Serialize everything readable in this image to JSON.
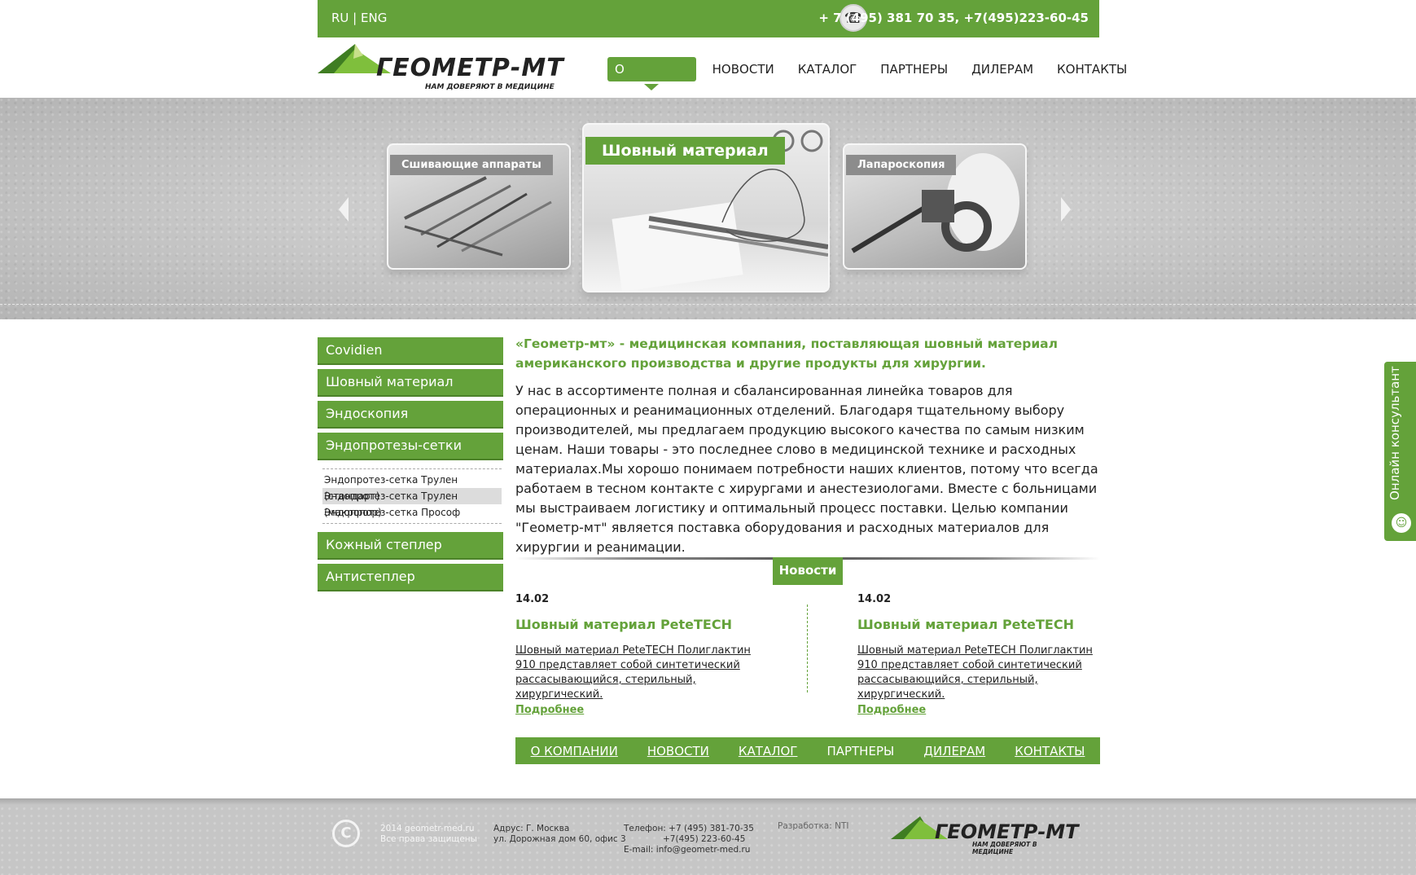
{
  "topbar": {
    "lang_ru": "RU",
    "lang_sep": " | ",
    "lang_eng": "ENG",
    "phone_icon": "phone-icon",
    "phone": "+ 7 (495) 381 70 35, +7(495)223-60-45"
  },
  "header": {
    "logo_text": "ГЕОМЕТР-МТ",
    "logo_sub": "НАМ ДОВЕРЯЮТ В МЕДИЦИНЕ",
    "nav": [
      {
        "label": "О КОМПАНИИ",
        "active": true
      },
      {
        "label": "НОВОСТИ"
      },
      {
        "label": "КАТАЛОГ"
      },
      {
        "label": "ПАРТНЕРЫ"
      },
      {
        "label": "ДИЛЕРАМ"
      },
      {
        "label": "КОНТАКТЫ"
      }
    ]
  },
  "slider": {
    "cards": [
      {
        "label": "Сшивающие аппараты"
      },
      {
        "label": "Шовный материал"
      },
      {
        "label": "Лапароскопия"
      }
    ]
  },
  "sidebar": {
    "items": [
      {
        "label": "Covidien"
      },
      {
        "label": "Шовный материал"
      },
      {
        "label": "Эндоскопия"
      },
      {
        "label": "Эндопротезы-сетки"
      }
    ],
    "sub_items": [
      {
        "label": "Эндопротез-сетка Трулен (стандарт)"
      },
      {
        "label": "Эндопротез-сетка Трулен (макропор)"
      },
      {
        "label": "Эндопротез-сетка Прософ"
      }
    ],
    "items_after": [
      {
        "label": "Кожный степлер"
      },
      {
        "label": "Антистеплер"
      }
    ]
  },
  "main": {
    "lead": "«Геометр-мт» - медицинская компания, поставляющая шовный материал американского производства и другие продукты для хирургии.",
    "body": "У нас в ассортименте полная и сбалансированная линейка товаров для операционных и реанимационных отделений. Благодаря тщательному выбору производителей, мы предлагаем продукцию высокого качества по самым низким ценам. Наши товары - это последнее слово в медицинской технике и расходных материалах.Мы хорошо понимаем потребности наших клиентов, потому что всегда работаем в тесном контакте с хирургами и анестезиологами. Вместе с больницами мы выстраиваем логистику и оптимальный процесс поставки. Целью компании \"Геометр-мт\" является поставка оборудования и расходных материалов для хирургии и реанимации."
  },
  "news": {
    "label": "Новости",
    "items": [
      {
        "date": "14.02",
        "title": "Шовный материал PeteTECH",
        "text": "Шовный материал PeteTECH Полиглактин 910 представляет собой синтетический рассасывающийся, стерильный, хирургический.",
        "more": "Подробнее"
      },
      {
        "date": "14.02",
        "title": "Шовный материал PeteTECH",
        "text": "Шовный материал PeteTECH Полиглактин 910 представляет собой синтетический рассасывающийся, стерильный, хирургический.",
        "more": "Подробнее"
      }
    ]
  },
  "bottom_nav": [
    "О КОМПАНИИ",
    "НОВОСТИ",
    "КАТАЛОГ",
    "ПАРТНЕРЫ",
    "ДИЛЕРАМ",
    "КОНТАКТЫ"
  ],
  "footer": {
    "copyright_symbol": "C",
    "copyright_line1": "2014 geometr-med.ru",
    "copyright_line2": "Все права защищены",
    "address_line1": "Адрус: Г. Москва",
    "address_line2": "ул. Дорожная дом 60, офис 3",
    "phone_line1": "Телефон: +7 (495) 381-70-35",
    "phone_line2": "+7(495) 223-60-45",
    "email": "E-mail: info@geometr-med.ru",
    "dev_label": "Разработка:",
    "dev_name": " NTI",
    "logo_text": "ГЕОМЕТР-МТ",
    "logo_sub": "НАМ ДОВЕРЯЮТ В МЕДИЦИНЕ"
  },
  "consultant": {
    "label": "Онлайн консультант",
    "icon": "user-icon"
  },
  "colors": {
    "brand_green": "#64a23a",
    "slider_grey": "#c4c4c4"
  }
}
